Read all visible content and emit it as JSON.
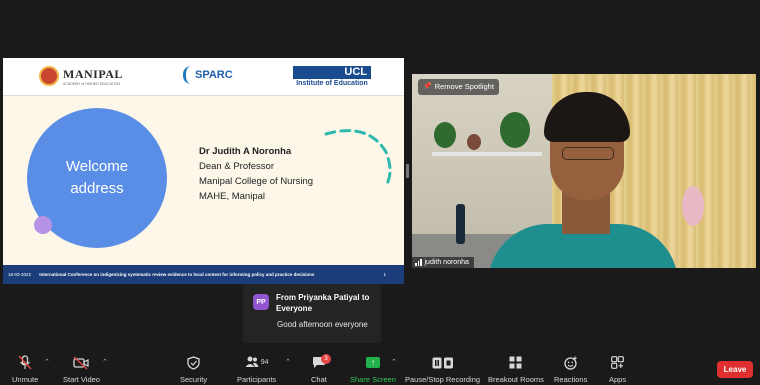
{
  "slide": {
    "logos": {
      "manipal_name": "MANIPAL",
      "manipal_sub": "ACADEMY of HIGHER EDUCATION",
      "sparc_name": "SPARC",
      "ucl_name": "UCL",
      "ucl_sub": "Institute of Education"
    },
    "welcome_line1": "Welcome",
    "welcome_line2": "address",
    "speaker_name": "Dr Judith A Noronha",
    "speaker_role": "Dean & Professor",
    "speaker_college": "Manipal College of Nursing",
    "speaker_org": "MAHE, Manipal",
    "footer_date": "16-03-2022",
    "footer_conference": "International Conference on indigenizing systematic review evidence to local context for informing policy and practice decisions",
    "footer_page": "1"
  },
  "video": {
    "spotlight_label": "Remove Spotlight",
    "participant_name": "judith noronha"
  },
  "chat_popup": {
    "avatar_initials": "PP",
    "from": "From Priyanka Patiyal to Everyone",
    "message": "Good afternoon everyone"
  },
  "toolbar": {
    "unmute": "Unmute",
    "start_video": "Start Video",
    "security": "Security",
    "participants": "Participants",
    "participants_count": "94",
    "chat": "Chat",
    "chat_badge": "3",
    "share_screen": "Share Screen",
    "record": "Pause/Stop Recording",
    "breakout": "Breakout Rooms",
    "reactions": "Reactions",
    "apps": "Apps",
    "leave": "Leave"
  },
  "colors": {
    "leave": "#e02f2f",
    "share_green": "#22b24c",
    "chat_badge": "#e54646",
    "avatar": "#9155cf"
  }
}
